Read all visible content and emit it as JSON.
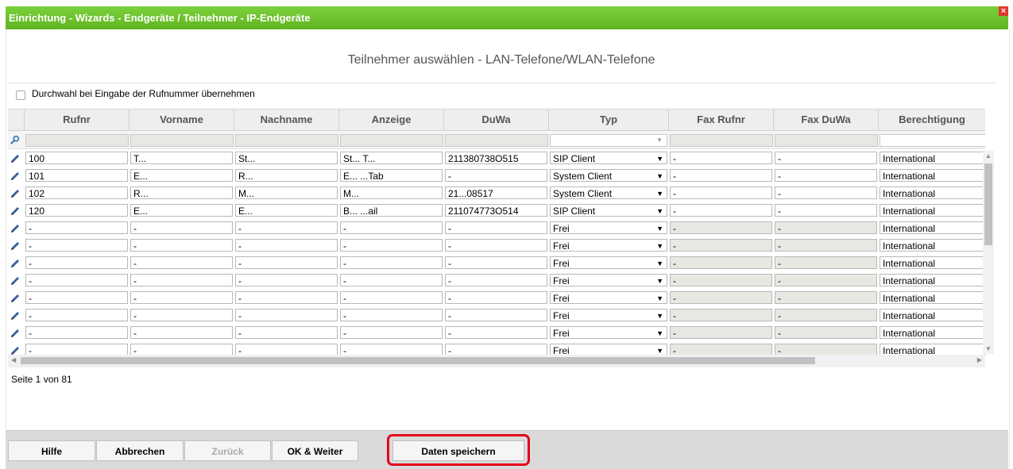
{
  "window": {
    "title": "Einrichtung - Wizards - Endgeräte / Teilnehmer - IP-Endgeräte",
    "close_label": "×",
    "subtitle": "Teilnehmer auswählen - LAN-Telefone/WLAN-Telefone"
  },
  "option": {
    "label": "Durchwahl bei Eingabe der Rufnummer übernehmen",
    "checked": false
  },
  "table": {
    "columns": [
      "Rufnr",
      "Vorname",
      "Nachname",
      "Anzeige",
      "DuWa",
      "Typ",
      "Fax Rufnr",
      "Fax DuWa",
      "Berechtigung"
    ],
    "rows": [
      {
        "rufnr": "100",
        "vorname": "T...",
        "nachname": "St...",
        "anzeige": "St... T...",
        "duwa": "211380738O515",
        "typ": "SIP Client",
        "fax_rufnr": "-",
        "fax_duwa": "-",
        "berechtigung": "International"
      },
      {
        "rufnr": "101",
        "vorname": "E...",
        "nachname": "R...",
        "anzeige": "E... ...Tab",
        "duwa": "-",
        "typ": "System Client",
        "fax_rufnr": "-",
        "fax_duwa": "-",
        "berechtigung": "International"
      },
      {
        "rufnr": "102",
        "vorname": "R...",
        "nachname": "M...",
        "anzeige": "M...",
        "duwa": "21...08517",
        "typ": "System Client",
        "fax_rufnr": "-",
        "fax_duwa": "-",
        "berechtigung": "International"
      },
      {
        "rufnr": "120",
        "vorname": "E...",
        "nachname": "E...",
        "anzeige": "B... ...ail",
        "duwa": "211074773O514",
        "typ": "SIP Client",
        "fax_rufnr": "-",
        "fax_duwa": "-",
        "berechtigung": "International"
      },
      {
        "rufnr": "-",
        "vorname": "-",
        "nachname": "-",
        "anzeige": "-",
        "duwa": "-",
        "typ": "Frei",
        "fax_rufnr": "-",
        "fax_duwa": "-",
        "berechtigung": "International"
      },
      {
        "rufnr": "-",
        "vorname": "-",
        "nachname": "-",
        "anzeige": "-",
        "duwa": "-",
        "typ": "Frei",
        "fax_rufnr": "-",
        "fax_duwa": "-",
        "berechtigung": "International"
      },
      {
        "rufnr": "-",
        "vorname": "-",
        "nachname": "-",
        "anzeige": "-",
        "duwa": "-",
        "typ": "Frei",
        "fax_rufnr": "-",
        "fax_duwa": "-",
        "berechtigung": "International"
      },
      {
        "rufnr": "-",
        "vorname": "-",
        "nachname": "-",
        "anzeige": "-",
        "duwa": "-",
        "typ": "Frei",
        "fax_rufnr": "-",
        "fax_duwa": "-",
        "berechtigung": "International"
      },
      {
        "rufnr": "-",
        "vorname": "-",
        "nachname": "-",
        "anzeige": "-",
        "duwa": "-",
        "typ": "Frei",
        "fax_rufnr": "-",
        "fax_duwa": "-",
        "berechtigung": "International"
      },
      {
        "rufnr": "-",
        "vorname": "-",
        "nachname": "-",
        "anzeige": "-",
        "duwa": "-",
        "typ": "Frei",
        "fax_rufnr": "-",
        "fax_duwa": "-",
        "berechtigung": "International"
      },
      {
        "rufnr": "-",
        "vorname": "-",
        "nachname": "-",
        "anzeige": "-",
        "duwa": "-",
        "typ": "Frei",
        "fax_rufnr": "-",
        "fax_duwa": "-",
        "berechtigung": "International"
      },
      {
        "rufnr": "-",
        "vorname": "-",
        "nachname": "-",
        "anzeige": "-",
        "duwa": "-",
        "typ": "Frei",
        "fax_rufnr": "-",
        "fax_duwa": "-",
        "berechtigung": "International"
      }
    ]
  },
  "pagination": {
    "text": "Seite 1 von 81"
  },
  "buttons": {
    "help": "Hilfe",
    "cancel": "Abbrechen",
    "back": "Zurück",
    "ok_next": "OK & Weiter",
    "save": "Daten speichern"
  },
  "colors": {
    "titlebar": "#6ac22a",
    "highlight": "#e3001b",
    "close": "#e2362c"
  },
  "icons": {
    "filter": "magnifier-icon",
    "row_edit": "pencil-icon",
    "dropdown": "dropdown-arrow-icon"
  }
}
